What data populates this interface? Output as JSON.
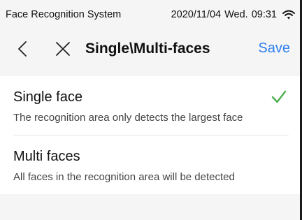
{
  "status_bar": {
    "app_name": "Face Recognition System",
    "date": "2020/11/04",
    "weekday": "Wed.",
    "time": "09:31",
    "signal_icon": "wifi-icon"
  },
  "nav": {
    "back_icon": "chevron-left-icon",
    "close_icon": "close-icon",
    "title": "Single\\Multi-faces",
    "save_label": "Save"
  },
  "options": [
    {
      "title": "Single face",
      "description": "The recognition area only detects the largest face",
      "selected": true
    },
    {
      "title": "Multi faces",
      "description": "All faces in the recognition area will be detected",
      "selected": false
    }
  ],
  "colors": {
    "accent": "#2f80ed",
    "check": "#4caf50",
    "background": "#f5f5f5"
  }
}
